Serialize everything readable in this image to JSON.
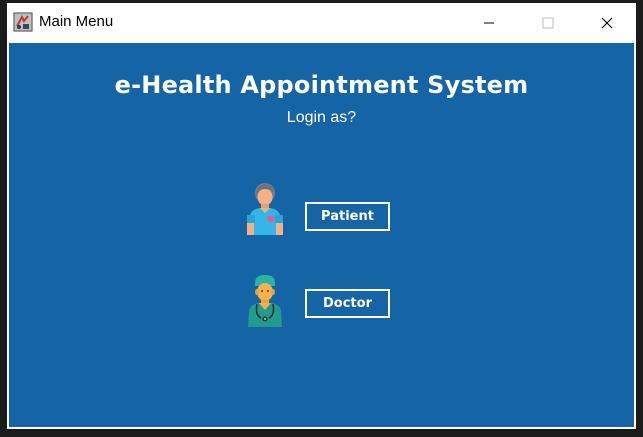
{
  "window": {
    "title": "Main Menu"
  },
  "main": {
    "heading": "e-Health Appointment System",
    "subheading": "Login as?",
    "roles": [
      {
        "label": "Patient",
        "icon": "patient-icon"
      },
      {
        "label": "Doctor",
        "icon": "doctor-icon"
      }
    ]
  },
  "colors": {
    "background": "#1565a6",
    "text": "#ffffff"
  }
}
